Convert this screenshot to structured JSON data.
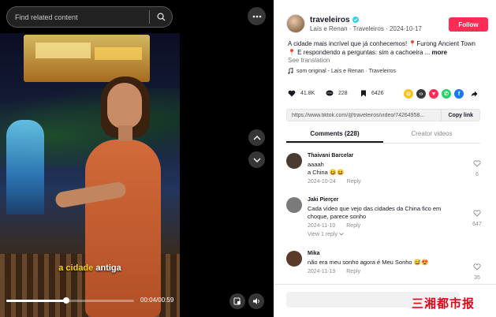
{
  "search": {
    "placeholder": "Find related content"
  },
  "video": {
    "caption_highlight": "a cidade",
    "caption_rest": "antiga",
    "time_label": "00:04/00:59",
    "progress": 0.47
  },
  "author": {
    "name": "traveleiros",
    "subtitle": "Laís e Renan · Traveleiros · 2024-10-17",
    "follow_label": "Follow"
  },
  "description": {
    "text": "A cidade mais incrível que já conhecemos! 📍Furong Ancient Town 📍 E respondendo a perguntas: sim a cachoeira ...",
    "more_label": "more",
    "see_translation": "See translation",
    "music": "som original - Laís e Renan · Traveleiros"
  },
  "stats": {
    "likes": "41.8K",
    "comments": "228",
    "saves": "6426"
  },
  "share": {
    "icons": [
      {
        "name": "coin-share-icon",
        "color": "#f8c31c",
        "glyph": "⊙"
      },
      {
        "name": "embed-share-icon",
        "color": "#3a3a3a",
        "glyph": "‹›"
      },
      {
        "name": "send-share-icon",
        "color": "#fe2c55",
        "glyph": "▼"
      },
      {
        "name": "whatsapp-share-icon",
        "color": "#25d366",
        "glyph": "✆"
      },
      {
        "name": "facebook-share-icon",
        "color": "#1877f2",
        "glyph": "f"
      }
    ]
  },
  "link": {
    "url": "https://www.tiktok.com/@traveleiros/video/74264958...",
    "copy_label": "Copy link"
  },
  "tabs": [
    {
      "label": "Comments (228)",
      "active": true
    },
    {
      "label": "Creator videos",
      "active": false
    }
  ],
  "comments": [
    {
      "user": "Thaivani Barcelar",
      "text_lines": [
        "aaaah",
        "a China 😆😆"
      ],
      "date": "2024-10-24",
      "reply_label": "Reply",
      "likes": "6",
      "avatar_color": "#4a3a30"
    },
    {
      "user": "Jaki Pierçer",
      "text_lines": [
        "Cada vídeo que vejo das cidades da China fico em",
        "choque, parece sonho"
      ],
      "date": "2024-11-10",
      "reply_label": "Reply",
      "view_replies": "View 1 reply",
      "likes": "647",
      "avatar_color": "#7a7a7a"
    },
    {
      "user": "Mika",
      "text_lines": [
        "não era meu sonho agora é Meu Sonho 😅😍"
      ],
      "date": "2024-11-19",
      "reply_label": "Reply",
      "likes": "35",
      "avatar_color": "#5a3a28"
    }
  ],
  "footer": {
    "watermark": "三湘都市报"
  },
  "colors": {
    "accent": "#fe2c55",
    "verified": "#20d5ec",
    "caption_highlight": "#ffd400"
  }
}
